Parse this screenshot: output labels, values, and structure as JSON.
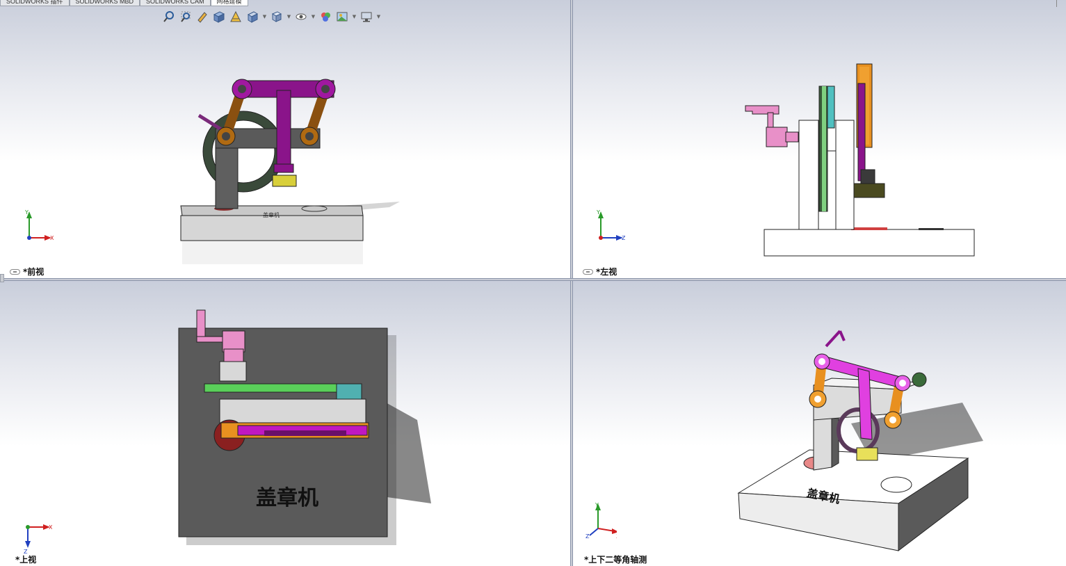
{
  "tabs": [
    {
      "label": "SOLIDWORKS 插件"
    },
    {
      "label": "SOLIDWORKS MBD"
    },
    {
      "label": "SOLIDWORKS CAM"
    },
    {
      "label": "网格建模"
    }
  ],
  "toolbar": {
    "icons": [
      "zoom-to-fit-icon",
      "zoom-to-area-icon",
      "previous-view-icon",
      "section-view-icon",
      "dynamic-annotation-icon",
      "view-orientation-icon",
      "display-style-icon",
      "hide-show-items-icon",
      "edit-appearance-icon",
      "apply-scene-icon",
      "view-settings-icon"
    ]
  },
  "viewports": {
    "front": {
      "label": "*前视",
      "axes": {
        "vertical": "Y",
        "horizontal": "X"
      }
    },
    "left": {
      "label": "*左视",
      "axes": {
        "vertical": "Y",
        "horizontal": "Z"
      }
    },
    "top": {
      "label": "*上视",
      "axes": {
        "vertical": "Z",
        "horizontal": "X"
      }
    },
    "iso": {
      "label": "*上下二等角轴测",
      "axes": {
        "vertical": "Y",
        "horizontal": "X",
        "depth": "Z"
      }
    }
  },
  "model": {
    "engraving": "盖章机",
    "colors": {
      "base": "#d9d9d9",
      "frame": "#5f5f5f",
      "t_arm": "#b418b4",
      "links": "#c87a10",
      "handle": "#e88cc8",
      "stamp": "#e8e05a",
      "pad_red": "#d46a6a",
      "gear_green": "#64c864"
    }
  }
}
